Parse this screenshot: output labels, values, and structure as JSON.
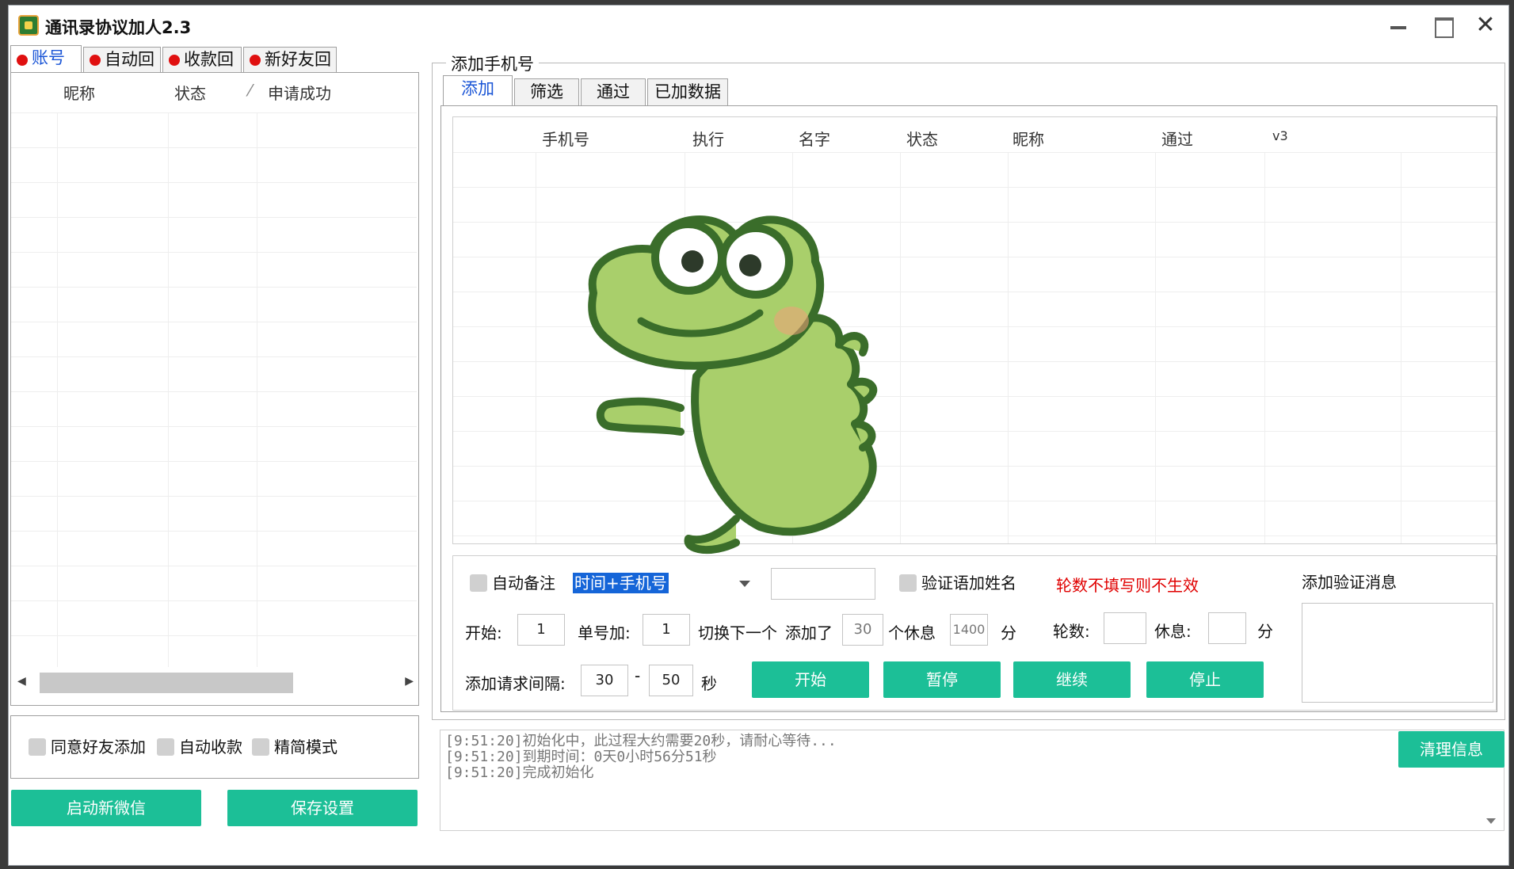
{
  "window": {
    "title": "通讯录协议加人2.3"
  },
  "left_tabs": [
    "账号列",
    "自动回复",
    "收款回复",
    "新好友回复"
  ],
  "account_table": {
    "columns": [
      "昵称",
      "状态",
      "",
      "申请成功"
    ]
  },
  "left_options": {
    "agree_friend": "同意好友添加",
    "auto_receive": "自动收款",
    "simple_mode": "精简模式"
  },
  "left_buttons": {
    "start_wechat": "启动新微信",
    "save_settings": "保存设置"
  },
  "group_title": "添加手机号",
  "right_tabs": [
    "添加",
    "筛选",
    "通过",
    "已加数据"
  ],
  "phone_table": {
    "columns": [
      "手机号",
      "执行",
      "名字",
      "状态",
      "昵称",
      "通过",
      "v3"
    ]
  },
  "controls": {
    "auto_remark": "自动备注",
    "remark_combo_value": "时间+手机号",
    "verify_name": "验证语加姓名",
    "warning": "轮数不填写则不生效",
    "add_verify_msg": "添加验证消息",
    "start_label": "开始:",
    "start_value": "1",
    "per_label": "单号加:",
    "per_value": "1",
    "switch_label": "切换下一个",
    "added_label": "添加了",
    "added_value": "30",
    "rest_label": "个休息",
    "rest_value": "1400",
    "minute1": "分",
    "rounds_label": "轮数:",
    "rounds_value": "",
    "rest2_label": "休息:",
    "rest2_value": "",
    "minute2": "分",
    "interval_label": "添加请求间隔:",
    "interval_min": "30",
    "interval_dash": "-",
    "interval_max": "50",
    "seconds": "秒",
    "btn_start": "开始",
    "btn_pause": "暂停",
    "btn_continue": "继续",
    "btn_stop": "停止"
  },
  "log": {
    "lines": [
      "[9:51:20]初始化中，此过程大约需要20秒，请耐心等待...",
      "[9:51:20]到期时间：0天0小时56分51秒",
      "[9:51:20]完成初始化"
    ],
    "clear_button": "清理信息"
  }
}
